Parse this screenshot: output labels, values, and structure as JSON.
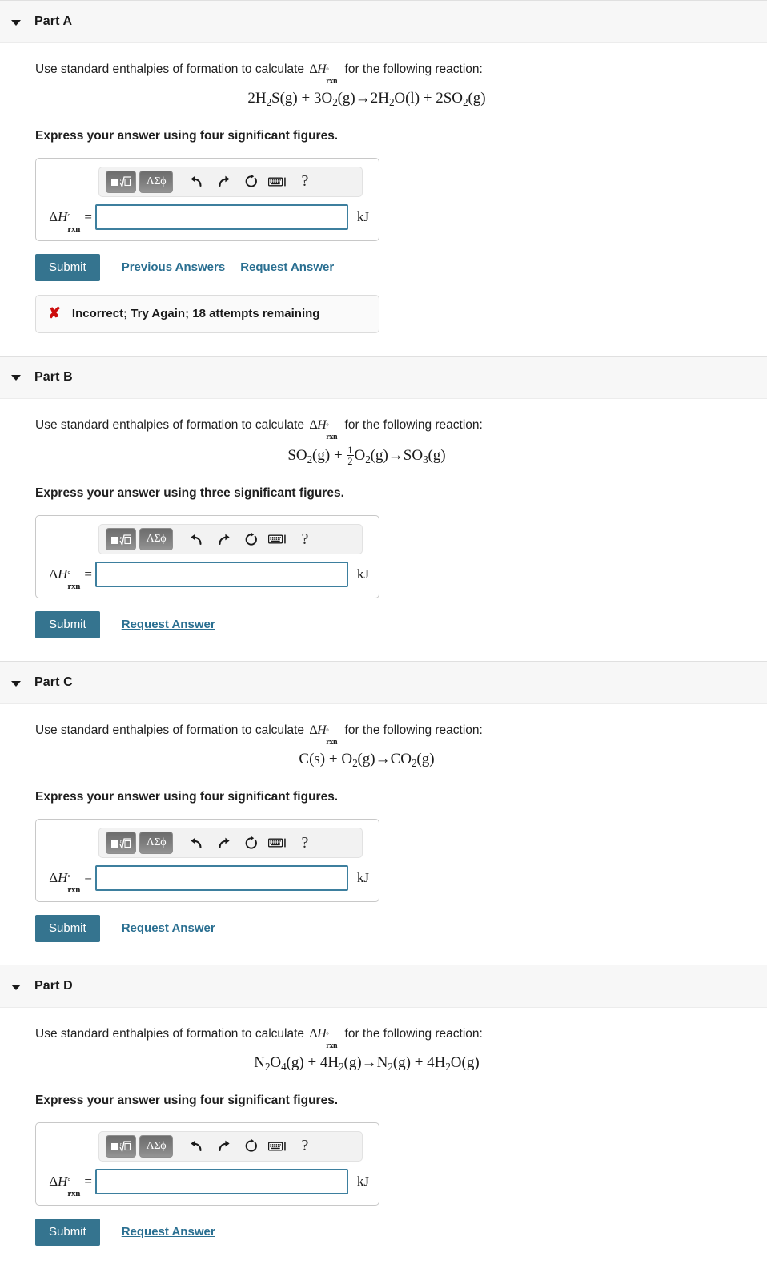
{
  "parts": [
    {
      "title": "Part A",
      "prompt_before": "Use standard enthalpies of formation to calculate",
      "prompt_after": "for the following reaction:",
      "equation_html": "2H<span class=\"sub\">2</span>S(g) + 3O<span class=\"sub\">2</span>(g)→2H<span class=\"sub\">2</span>O(l) + 2SO<span class=\"sub\">2</span>(g)",
      "equation_text": "2H2S(g) + 3O2(g)→2H2O(l) + 2SO2(g)",
      "instruction": "Express your answer using four significant figures.",
      "answer_label": "ΔH°rxn =",
      "answer_value": "",
      "answer_placeholder": "",
      "unit": "kJ",
      "submit_label": "Submit",
      "links": [
        "Previous Answers",
        "Request Answer"
      ],
      "feedback": {
        "icon": "incorrect-x-icon",
        "text": "Incorrect; Try Again; 18 attempts remaining"
      }
    },
    {
      "title": "Part B",
      "prompt_before": "Use standard enthalpies of formation to calculate",
      "prompt_after": "for the following reaction:",
      "equation_html": "SO<span class=\"sub\">2</span>(g) + <span class=\"frac\"><span class=\"num\">1</span><span class=\"den\">2</span></span>O<span class=\"sub\">2</span>(g)→SO<span class=\"sub\">3</span>(g)",
      "equation_text": "SO2(g) + 1/2 O2(g)→SO3(g)",
      "instruction": "Express your answer using three significant figures.",
      "answer_label": "ΔH°rxn =",
      "answer_value": "",
      "answer_placeholder": "",
      "unit": "kJ",
      "submit_label": "Submit",
      "links": [
        "Request Answer"
      ],
      "feedback": null
    },
    {
      "title": "Part C",
      "prompt_before": "Use standard enthalpies of formation to calculate",
      "prompt_after": "for the following reaction:",
      "equation_html": "C(s) + O<span class=\"sub\">2</span>(g)→CO<span class=\"sub\">2</span>(g)",
      "equation_text": "C(s) + O2(g)→CO2(g)",
      "instruction": "Express your answer using four significant figures.",
      "answer_label": "ΔH°rxn =",
      "answer_value": "",
      "answer_placeholder": "",
      "unit": "kJ",
      "submit_label": "Submit",
      "links": [
        "Request Answer"
      ],
      "feedback": null
    },
    {
      "title": "Part D",
      "prompt_before": "Use standard enthalpies of formation to calculate",
      "prompt_after": "for the following reaction:",
      "equation_html": "N<span class=\"sub\">2</span>O<span class=\"sub\">4</span>(g) + 4H<span class=\"sub\">2</span>(g)→N<span class=\"sub\">2</span>(g) + 4H<span class=\"sub\">2</span>O(g)",
      "equation_text": "N2O4(g) + 4H2(g)→N2(g) + 4H2O(g)",
      "instruction": "Express your answer using four significant figures.",
      "answer_label": "ΔH°rxn =",
      "answer_value": "",
      "answer_placeholder": "",
      "unit": "kJ",
      "submit_label": "Submit",
      "links": [
        "Request Answer"
      ],
      "feedback": null
    }
  ],
  "toolbar": {
    "template_button": "template-math-icon",
    "greek_button": "ΛΣϕ",
    "undo": "undo-icon",
    "redo": "redo-icon",
    "reset": "reset-icon",
    "keyboard": "keyboard-icon",
    "help": "?"
  },
  "colors": {
    "submit": "#35748f",
    "link": "#2a6f91",
    "input_border": "#3d7f9e",
    "header_bg": "#f7f7f7",
    "error": "#cc0c0c"
  }
}
